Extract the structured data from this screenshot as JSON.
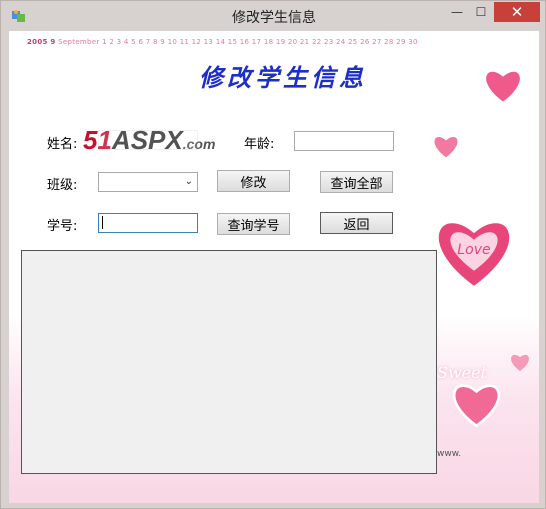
{
  "window": {
    "title": "修改学生信息",
    "minimize_glyph": "—",
    "maximize_glyph": "☐",
    "close_glyph": "✕"
  },
  "banner": {
    "calendar_year_month": "2005 9",
    "calendar_month_name": "September",
    "calendar_days": "1 2 3 4 5 6 7 8 9 10 11 12 13 14 15 16 17 18 19 20 21 22 23 24 25 26 27 28 29 30",
    "heading": "修改学生信息",
    "logo_51": "51",
    "logo_aspx": "ASPX",
    "logo_com": ".com",
    "sweet_text": "Sweet",
    "heart_text": "Love",
    "watermark": "www."
  },
  "form": {
    "name_label": "姓名:",
    "name_value": "",
    "age_label": "年龄:",
    "age_value": "",
    "class_label": "班级:",
    "class_value": "",
    "student_no_label": "学号:",
    "student_no_value": ""
  },
  "buttons": {
    "modify": "修改",
    "query_all": "查询全部",
    "query_student_no": "查询学号",
    "back": "返回"
  },
  "icons": {
    "app": "app-icon",
    "combo_arrow": "chevron-down-icon"
  },
  "colors": {
    "heading": "#1d2fc9",
    "close_button": "#c7403a",
    "logo_red": "#c8102e",
    "heart_pink": "#e8457a"
  }
}
